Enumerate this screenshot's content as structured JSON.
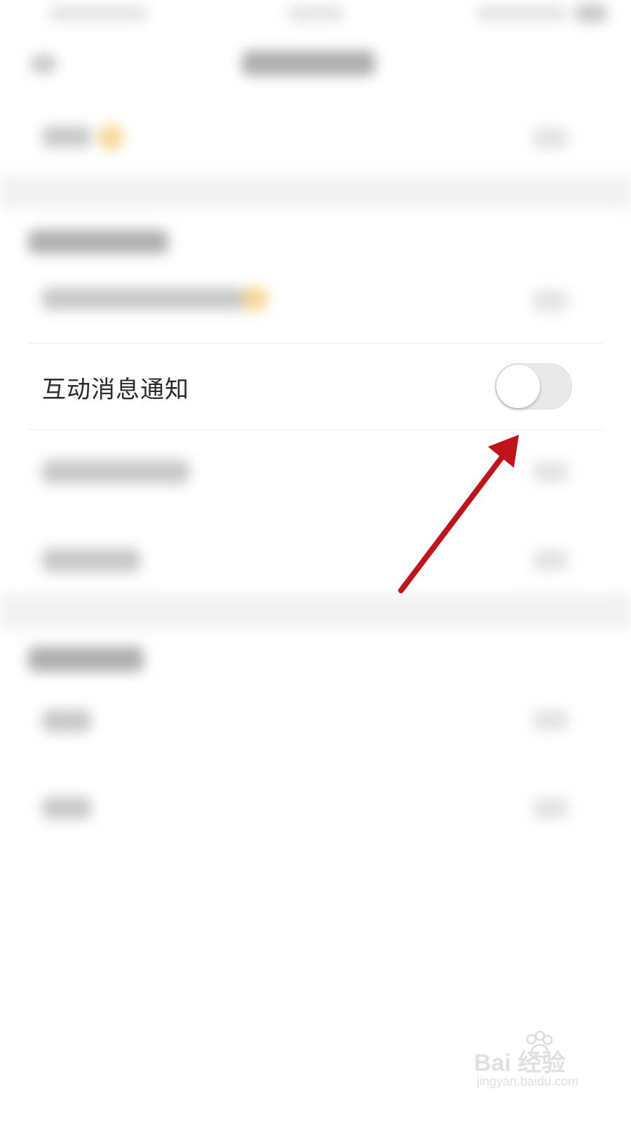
{
  "settings": {
    "interaction_notification": {
      "label": "互动消息通知",
      "enabled": false
    }
  },
  "watermark": {
    "brand": "Bai  经验",
    "url": "jingyan.baidu.com"
  },
  "colors": {
    "annotation_arrow": "#c0141a",
    "switch_track_off": "#e9e9e9",
    "label_text": "#2a2a2a"
  }
}
